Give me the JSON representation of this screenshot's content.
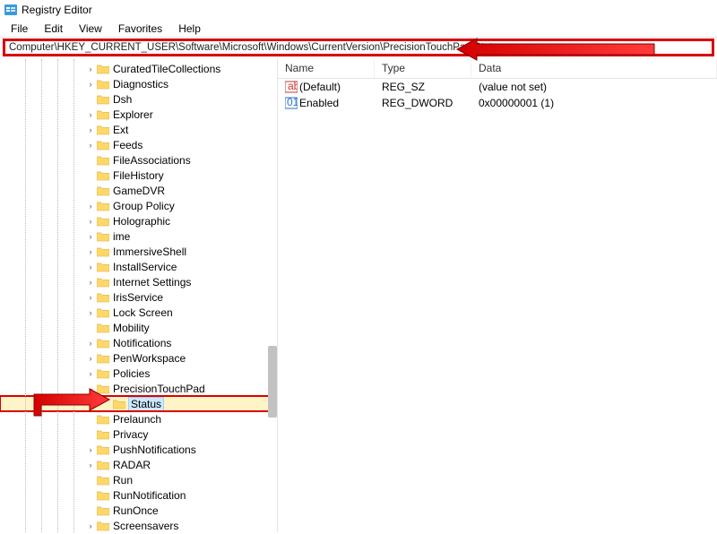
{
  "app": {
    "title": "Registry Editor"
  },
  "menu": {
    "file": "File",
    "edit": "Edit",
    "view": "View",
    "favorites": "Favorites",
    "help": "Help"
  },
  "address": {
    "value": "Computer\\HKEY_CURRENT_USER\\Software\\Microsoft\\Windows\\CurrentVersion\\PrecisionTouchPad\\Status"
  },
  "tree": {
    "items": [
      {
        "label": "CuratedTileCollections",
        "depth": 5,
        "exp": "closed"
      },
      {
        "label": "Diagnostics",
        "depth": 5,
        "exp": "closed"
      },
      {
        "label": "Dsh",
        "depth": 5,
        "exp": "none"
      },
      {
        "label": "Explorer",
        "depth": 5,
        "exp": "closed"
      },
      {
        "label": "Ext",
        "depth": 5,
        "exp": "closed"
      },
      {
        "label": "Feeds",
        "depth": 5,
        "exp": "closed"
      },
      {
        "label": "FileAssociations",
        "depth": 5,
        "exp": "none"
      },
      {
        "label": "FileHistory",
        "depth": 5,
        "exp": "none"
      },
      {
        "label": "GameDVR",
        "depth": 5,
        "exp": "none"
      },
      {
        "label": "Group Policy",
        "depth": 5,
        "exp": "closed"
      },
      {
        "label": "Holographic",
        "depth": 5,
        "exp": "closed"
      },
      {
        "label": "ime",
        "depth": 5,
        "exp": "closed"
      },
      {
        "label": "ImmersiveShell",
        "depth": 5,
        "exp": "closed"
      },
      {
        "label": "InstallService",
        "depth": 5,
        "exp": "closed"
      },
      {
        "label": "Internet Settings",
        "depth": 5,
        "exp": "closed"
      },
      {
        "label": "IrisService",
        "depth": 5,
        "exp": "closed"
      },
      {
        "label": "Lock Screen",
        "depth": 5,
        "exp": "closed"
      },
      {
        "label": "Mobility",
        "depth": 5,
        "exp": "none"
      },
      {
        "label": "Notifications",
        "depth": 5,
        "exp": "closed"
      },
      {
        "label": "PenWorkspace",
        "depth": 5,
        "exp": "closed"
      },
      {
        "label": "Policies",
        "depth": 5,
        "exp": "closed"
      },
      {
        "label": "PrecisionTouchPad",
        "depth": 5,
        "exp": "open"
      },
      {
        "label": "Status",
        "depth": 6,
        "exp": "none",
        "selected": true,
        "highlighted": true
      },
      {
        "label": "Prelaunch",
        "depth": 5,
        "exp": "none"
      },
      {
        "label": "Privacy",
        "depth": 5,
        "exp": "none"
      },
      {
        "label": "PushNotifications",
        "depth": 5,
        "exp": "closed"
      },
      {
        "label": "RADAR",
        "depth": 5,
        "exp": "closed"
      },
      {
        "label": "Run",
        "depth": 5,
        "exp": "none"
      },
      {
        "label": "RunNotification",
        "depth": 5,
        "exp": "none"
      },
      {
        "label": "RunOnce",
        "depth": 5,
        "exp": "none"
      },
      {
        "label": "Screensavers",
        "depth": 5,
        "exp": "closed"
      }
    ]
  },
  "list": {
    "headers": {
      "name": "Name",
      "type": "Type",
      "data": "Data"
    },
    "rows": [
      {
        "icon": "string",
        "name": "(Default)",
        "type": "REG_SZ",
        "data": "(value not set)"
      },
      {
        "icon": "binary",
        "name": "Enabled",
        "type": "REG_DWORD",
        "data": "0x00000001 (1)"
      }
    ]
  }
}
